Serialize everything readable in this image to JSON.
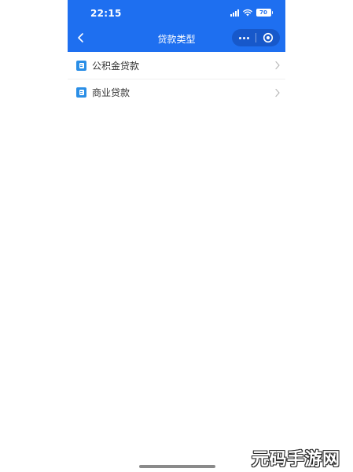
{
  "status_bar": {
    "time": "22:15",
    "battery": "70",
    "signal_icon": "cellular-signal-icon",
    "wifi_icon": "wifi-icon"
  },
  "nav": {
    "title": "贷款类型",
    "back_icon": "chevron-left-icon",
    "more_icon": "more-dots-icon",
    "close_icon": "target-circle-icon"
  },
  "list": {
    "items": [
      {
        "label": "公积金贷款",
        "icon": "document-icon"
      },
      {
        "label": "商业贷款",
        "icon": "briefcase-icon"
      }
    ],
    "arrow_icon": "chevron-right-icon"
  },
  "watermark": "元码手游网",
  "colors": {
    "header_bg": "#1e6ff0",
    "icon_blue": "#2a8ee6",
    "item_text": "#333333",
    "arrow": "#b8b8b8"
  }
}
